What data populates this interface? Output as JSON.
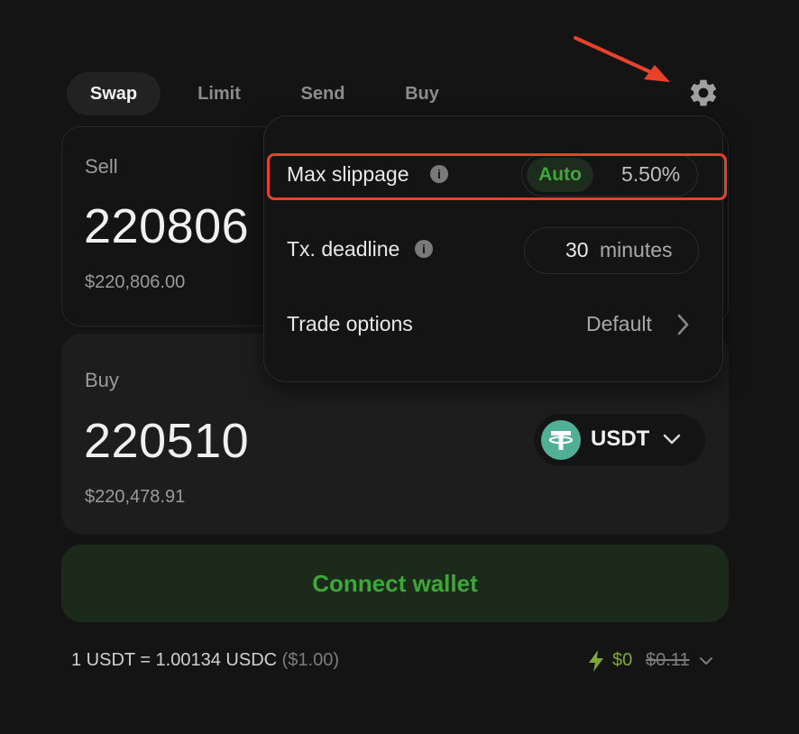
{
  "tabs": [
    {
      "label": "Swap",
      "active": true
    },
    {
      "label": "Limit",
      "active": false
    },
    {
      "label": "Send",
      "active": false
    },
    {
      "label": "Buy",
      "active": false
    }
  ],
  "sell": {
    "label": "Sell",
    "amount": "220806",
    "usd_value": "$220,806.00"
  },
  "buy": {
    "label": "Buy",
    "amount": "220510",
    "usd_value": "$220,478.91",
    "token": "USDT"
  },
  "connect_button": "Connect wallet",
  "rate": {
    "text": "1 USDT = 1.00134 USDC",
    "usd": "($1.00)"
  },
  "fee": {
    "current": "$0",
    "original": "$0.11"
  },
  "settings": {
    "max_slippage": {
      "label": "Max slippage",
      "mode": "Auto",
      "value": "5.50%"
    },
    "tx_deadline": {
      "label": "Tx. deadline",
      "value": "30",
      "unit": "minutes"
    },
    "trade_options": {
      "label": "Trade options",
      "value": "Default"
    }
  },
  "icons": {
    "settings": "gear-icon",
    "info": "info-icon",
    "token": "tether-icon",
    "chevron": "chevron-down-icon",
    "fee": "lightning-icon"
  },
  "colors": {
    "accent_green": "#3fa63a",
    "tether_green": "#50af95",
    "annotation_red": "#e8422b"
  }
}
